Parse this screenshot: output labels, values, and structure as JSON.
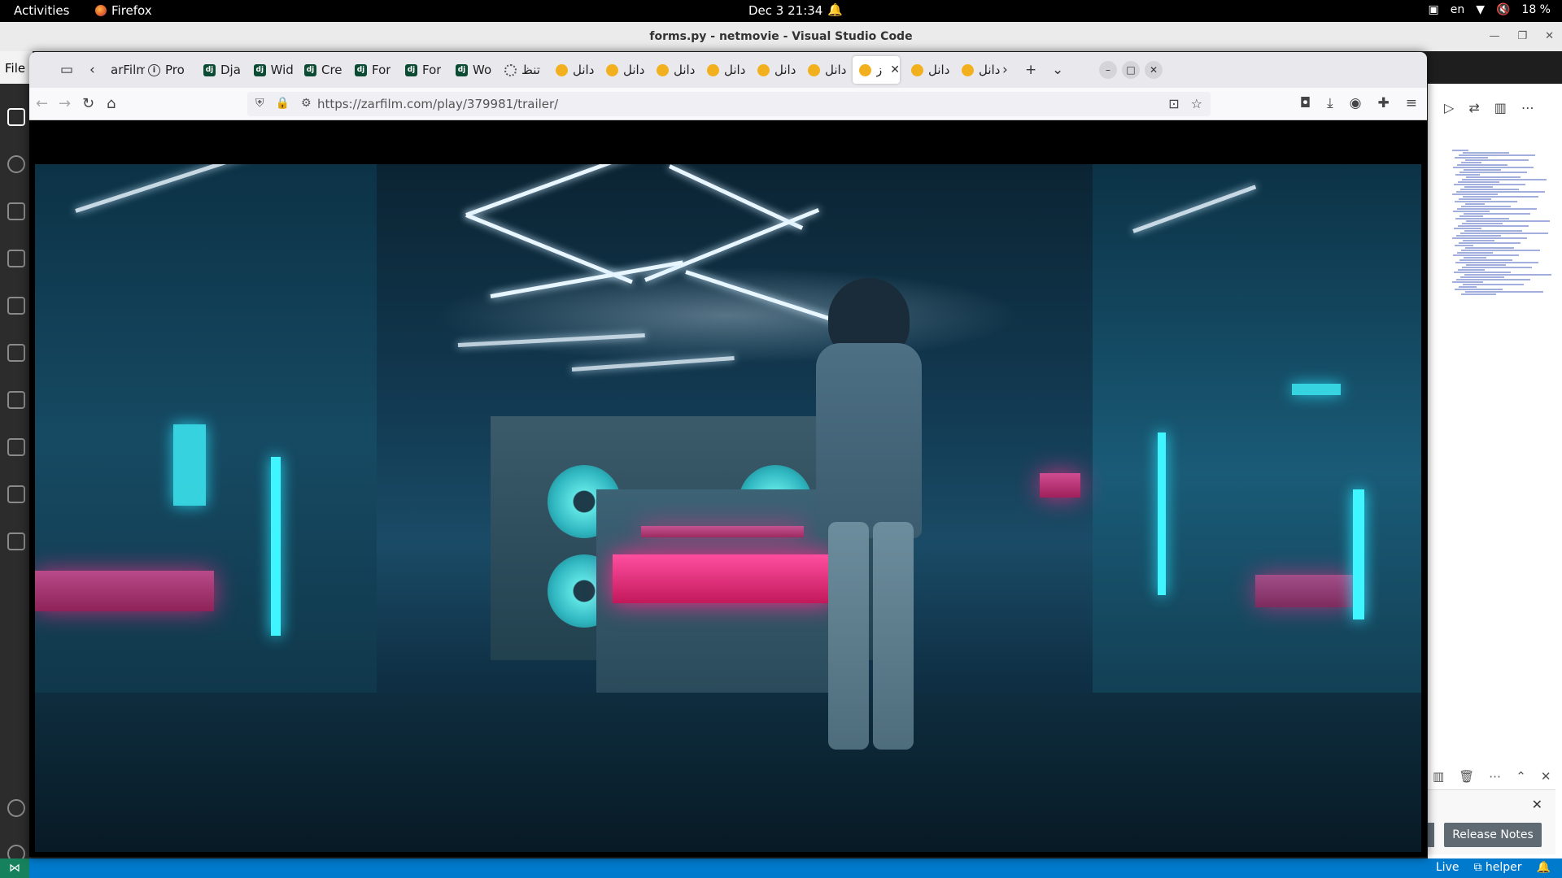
{
  "topbar": {
    "activities": "Activities",
    "app": "Firefox",
    "clock": "Dec 3  21:34",
    "lang": "en",
    "battery": "18 %"
  },
  "vscode": {
    "title": "forms.py - netmovie - Visual Studio Code",
    "menu_file": "File",
    "notification": {
      "button": "Release Notes"
    },
    "status": {
      "live": "Live",
      "helper": "helper"
    }
  },
  "firefox": {
    "tabs": [
      {
        "label": "arFilm",
        "icon": "overflow"
      },
      {
        "label": "Pro",
        "icon": "info"
      },
      {
        "label": "Dja",
        "icon": "dj"
      },
      {
        "label": "Wid",
        "icon": "dj"
      },
      {
        "label": "Cre",
        "icon": "dj"
      },
      {
        "label": "For",
        "icon": "dj"
      },
      {
        "label": "For",
        "icon": "dj"
      },
      {
        "label": "Wo",
        "icon": "dj"
      },
      {
        "label": "تنظ",
        "icon": "spin"
      },
      {
        "label": "دانل",
        "icon": "bee"
      },
      {
        "label": "دانل",
        "icon": "bee"
      },
      {
        "label": "دانل",
        "icon": "bee"
      },
      {
        "label": "دانل",
        "icon": "bee"
      },
      {
        "label": "دانل",
        "icon": "bee"
      },
      {
        "label": "دانل",
        "icon": "bee"
      },
      {
        "label": "ز",
        "icon": "bee",
        "active": true
      },
      {
        "label": "دانل",
        "icon": "bee"
      },
      {
        "label": "دانل",
        "icon": "bee"
      }
    ],
    "url": "https://zarfilm.com/play/379981/trailer/"
  }
}
